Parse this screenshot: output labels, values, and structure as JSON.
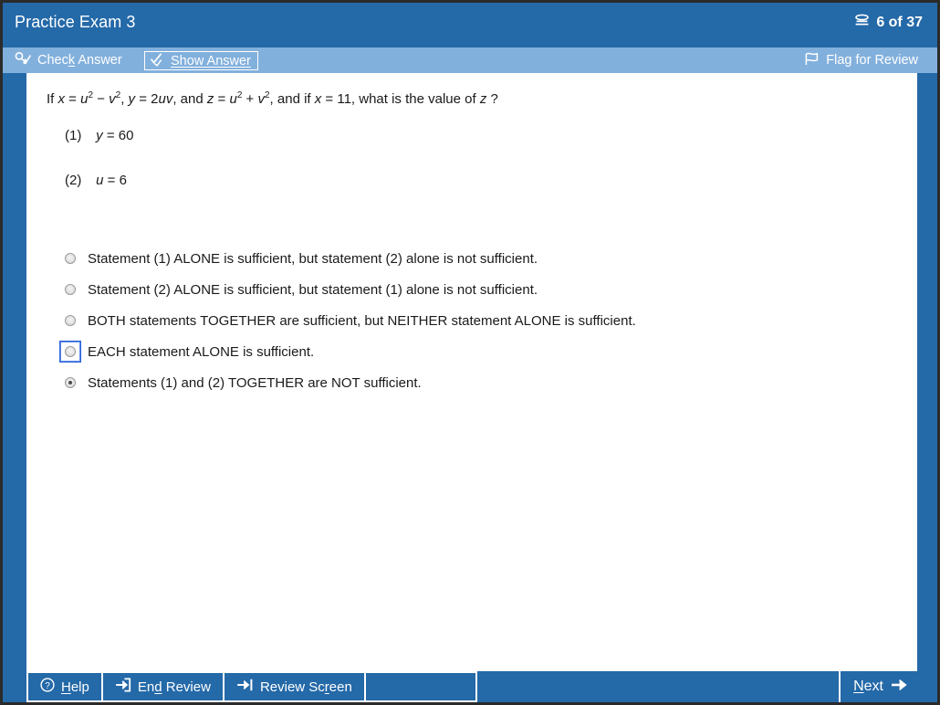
{
  "window": {
    "frame_color": "#2b2b2b",
    "chrome_color": "#2469a8",
    "toolbar_color": "#82b0dd"
  },
  "header": {
    "title": "Practice Exam 3",
    "progress": {
      "label": "6 of 37",
      "current": 6,
      "total": 37,
      "icon": "layers-icon"
    }
  },
  "toolbar": {
    "check_answer": {
      "label": "Check Answer",
      "mnemonic": "k",
      "icon": "key-check-icon"
    },
    "show_answer": {
      "label": "Show Answer",
      "mnemonic": "o",
      "icon": "checkmark-badge-icon",
      "focused": true
    },
    "flag_for_review": {
      "label": "Flag for Review",
      "icon": "flag-icon"
    }
  },
  "question": {
    "prefix": "If ",
    "full_text": "If x = u2 − v2, y = 2uv, and z = u2 + v2, and if x = 11, what is the value of z ?",
    "segments": [
      "If ",
      "x",
      " = ",
      "u",
      "2",
      " − ",
      "v",
      "2",
      ", ",
      "y",
      " = 2",
      "uv",
      ", and ",
      "z",
      " = ",
      "u",
      "2",
      " + ",
      "v",
      "2",
      ", and if ",
      "x",
      " = 11, what is the value of ",
      "z",
      " ?"
    ],
    "statements": [
      {
        "number": "(1)",
        "text_plain": "y = 60",
        "var": "y",
        "rest": " = 60"
      },
      {
        "number": "(2)",
        "text_plain": "u = 6",
        "var": "u",
        "rest": " = 6"
      }
    ]
  },
  "options": [
    {
      "id": "A",
      "label": "Statement (1) ALONE is sufficient, but statement (2) alone is not sufficient.",
      "selected": false,
      "focused": false
    },
    {
      "id": "B",
      "label": "Statement (2) ALONE is sufficient, but statement (1) alone is not sufficient.",
      "selected": false,
      "focused": false
    },
    {
      "id": "C",
      "label": "BOTH statements TOGETHER are sufficient, but NEITHER statement ALONE is sufficient.",
      "selected": false,
      "focused": false
    },
    {
      "id": "D",
      "label": "EACH statement ALONE is sufficient.",
      "selected": false,
      "focused": true
    },
    {
      "id": "E",
      "label": "Statements (1) and (2) TOGETHER are NOT sufficient.",
      "selected": true,
      "focused": false
    }
  ],
  "footer": {
    "help": {
      "label": "Help",
      "mnemonic": "H",
      "icon": "question-circle-icon"
    },
    "end_review": {
      "label": "End Review",
      "mnemonic": "d",
      "icon": "exit-arrow-icon"
    },
    "review_screen": {
      "label": "Review Screen",
      "mnemonic": "r",
      "icon": "arrow-to-bar-icon"
    },
    "next": {
      "label": "Next",
      "mnemonic": "N",
      "icon": "arrow-right-icon"
    }
  }
}
